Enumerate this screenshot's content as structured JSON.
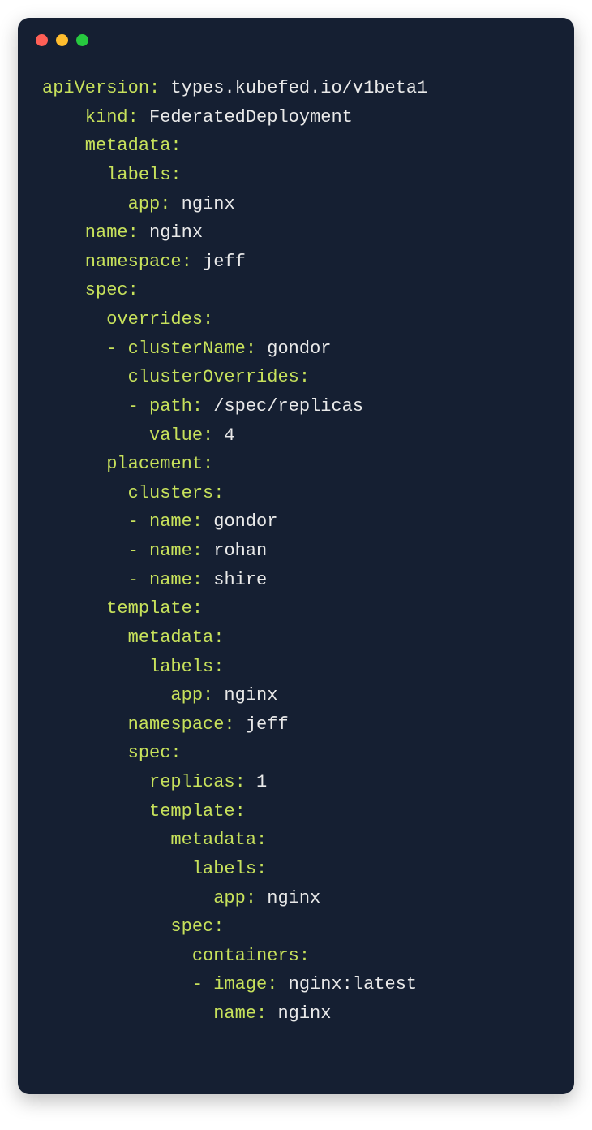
{
  "colors": {
    "background": "#151f32",
    "key": "#c7e15b",
    "value": "#e9e9e9"
  },
  "yaml": {
    "l1": {
      "k": "apiVersion:",
      "v": " types.kubefed.io/v1beta1"
    },
    "l2": {
      "k": "    kind:",
      "v": " FederatedDeployment"
    },
    "l3": {
      "k": "    metadata:",
      "v": ""
    },
    "l4": {
      "k": "      labels:",
      "v": ""
    },
    "l5": {
      "k": "        app:",
      "v": " nginx"
    },
    "l6": {
      "k": "    name:",
      "v": " nginx"
    },
    "l7": {
      "k": "    namespace:",
      "v": " jeff"
    },
    "l8": {
      "k": "    spec:",
      "v": ""
    },
    "l9": {
      "k": "      overrides:",
      "v": ""
    },
    "l10": {
      "pre": "      ",
      "dash": "-",
      "k": " clusterName:",
      "v": " gondor"
    },
    "l11": {
      "k": "        clusterOverrides:",
      "v": ""
    },
    "l12": {
      "pre": "        ",
      "dash": "-",
      "k": " path:",
      "v": " /spec/replicas"
    },
    "l13": {
      "k": "          value:",
      "v": " 4"
    },
    "l14": {
      "k": "      placement:",
      "v": ""
    },
    "l15": {
      "k": "        clusters:",
      "v": ""
    },
    "l16": {
      "pre": "        ",
      "dash": "-",
      "k": " name:",
      "v": " gondor"
    },
    "l17": {
      "pre": "        ",
      "dash": "-",
      "k": " name:",
      "v": " rohan"
    },
    "l18": {
      "pre": "        ",
      "dash": "-",
      "k": " name:",
      "v": " shire"
    },
    "l19": {
      "k": "      template:",
      "v": ""
    },
    "l20": {
      "k": "        metadata:",
      "v": ""
    },
    "l21": {
      "k": "          labels:",
      "v": ""
    },
    "l22": {
      "k": "            app:",
      "v": " nginx"
    },
    "l23": {
      "k": "        namespace:",
      "v": " jeff"
    },
    "l24": {
      "k": "        spec:",
      "v": ""
    },
    "l25": {
      "k": "          replicas:",
      "v": " 1"
    },
    "l26": {
      "k": "          template:",
      "v": ""
    },
    "l27": {
      "k": "            metadata:",
      "v": ""
    },
    "l28": {
      "k": "              labels:",
      "v": ""
    },
    "l29": {
      "k": "                app:",
      "v": " nginx"
    },
    "l30": {
      "k": "            spec:",
      "v": ""
    },
    "l31": {
      "k": "              containers:",
      "v": ""
    },
    "l32": {
      "pre": "              ",
      "dash": "-",
      "k": " image:",
      "v": " nginx:latest"
    },
    "l33": {
      "k": "                name:",
      "v": " nginx"
    }
  }
}
